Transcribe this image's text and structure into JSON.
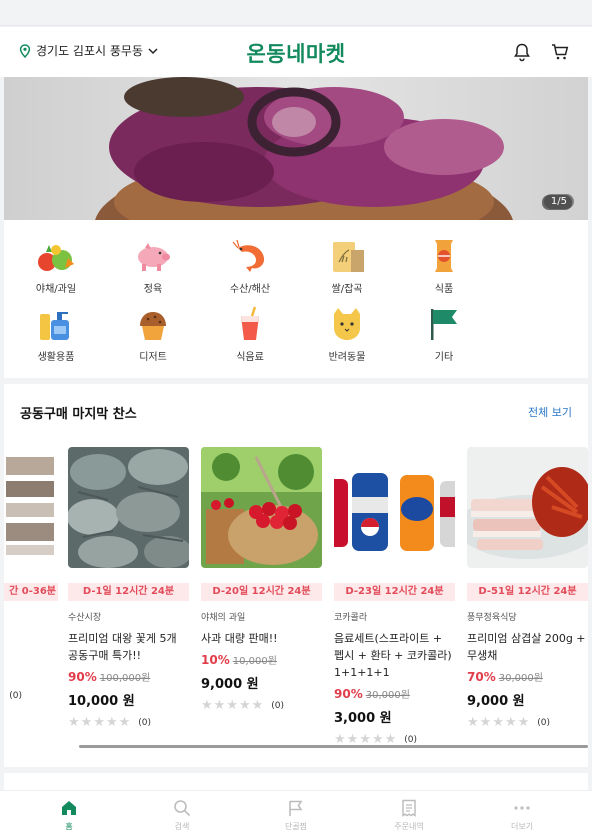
{
  "header": {
    "location": "경기도 김포시 풍무동",
    "logo": "온동네마켓",
    "icons": [
      "map-pin-icon",
      "chevron-down-icon",
      "bell-icon",
      "cart-icon"
    ]
  },
  "banner": {
    "pager": "1/5"
  },
  "categories": [
    {
      "label": "야채/과일",
      "icon": "vegetables-icon"
    },
    {
      "label": "정육",
      "icon": "pig-icon"
    },
    {
      "label": "수산/해산",
      "icon": "shrimp-icon"
    },
    {
      "label": "쌀/잡곡",
      "icon": "rice-bag-icon"
    },
    {
      "label": "식품",
      "icon": "snack-icon"
    },
    {
      "label": "생활용품",
      "icon": "household-icon"
    },
    {
      "label": "디저트",
      "icon": "muffin-icon"
    },
    {
      "label": "식음료",
      "icon": "drink-cup-icon"
    },
    {
      "label": "반려동물",
      "icon": "cat-icon"
    },
    {
      "label": "기타",
      "icon": "flag-icon"
    }
  ],
  "section": {
    "title": "공동구매 마지막 찬스",
    "see_all": "전체 보기",
    "partial_card": {
      "dday": "간 0-36분",
      "rating_count": "(0)"
    },
    "cards": [
      {
        "dday": "D-1일 12시간 24분",
        "store": "수산시장",
        "name": "프리미엄 대왕 꽃게 5개 공동구매 특가!!",
        "discount": "90%",
        "original": "100,000원",
        "price": "10,000 원",
        "rating_count": "(0)",
        "rating": 0
      },
      {
        "dday": "D-20일 12시간 24분",
        "store": "야채의 과일",
        "name": "사과 대량 판매!!",
        "discount": "10%",
        "original": "10,000원",
        "price": "9,000 원",
        "rating_count": "(0)",
        "rating": 0
      },
      {
        "dday": "D-23일 12시간 24분",
        "store": "코카콜라",
        "name": "음료세트(스프라이트 + 펩시 + 환타 + 코카콜라) 1+1+1+1",
        "discount": "90%",
        "original": "30,000원",
        "price": "3,000 원",
        "rating_count": "(0)",
        "rating": 0
      },
      {
        "dday": "D-51일 12시간 24분",
        "store": "풍무정육식당",
        "name": "프리미엄 삼겹살 200g + 무생채",
        "discount": "70%",
        "original": "30,000원",
        "price": "9,000 원",
        "rating_count": "(0)",
        "rating": 0
      }
    ]
  },
  "tabbar": [
    {
      "label": "홈",
      "icon": "home-icon",
      "active": true
    },
    {
      "label": "검색",
      "icon": "search-icon",
      "active": false
    },
    {
      "label": "단골찜",
      "icon": "flag-outline-icon",
      "active": false
    },
    {
      "label": "주문내역",
      "icon": "receipt-icon",
      "active": false
    },
    {
      "label": "더보기",
      "icon": "more-dots-icon",
      "active": false
    }
  ],
  "colors": {
    "brand": "#138a5e",
    "discount": "#e13d4a",
    "dday_bg": "#fde8ea",
    "link": "#2b78c6"
  }
}
